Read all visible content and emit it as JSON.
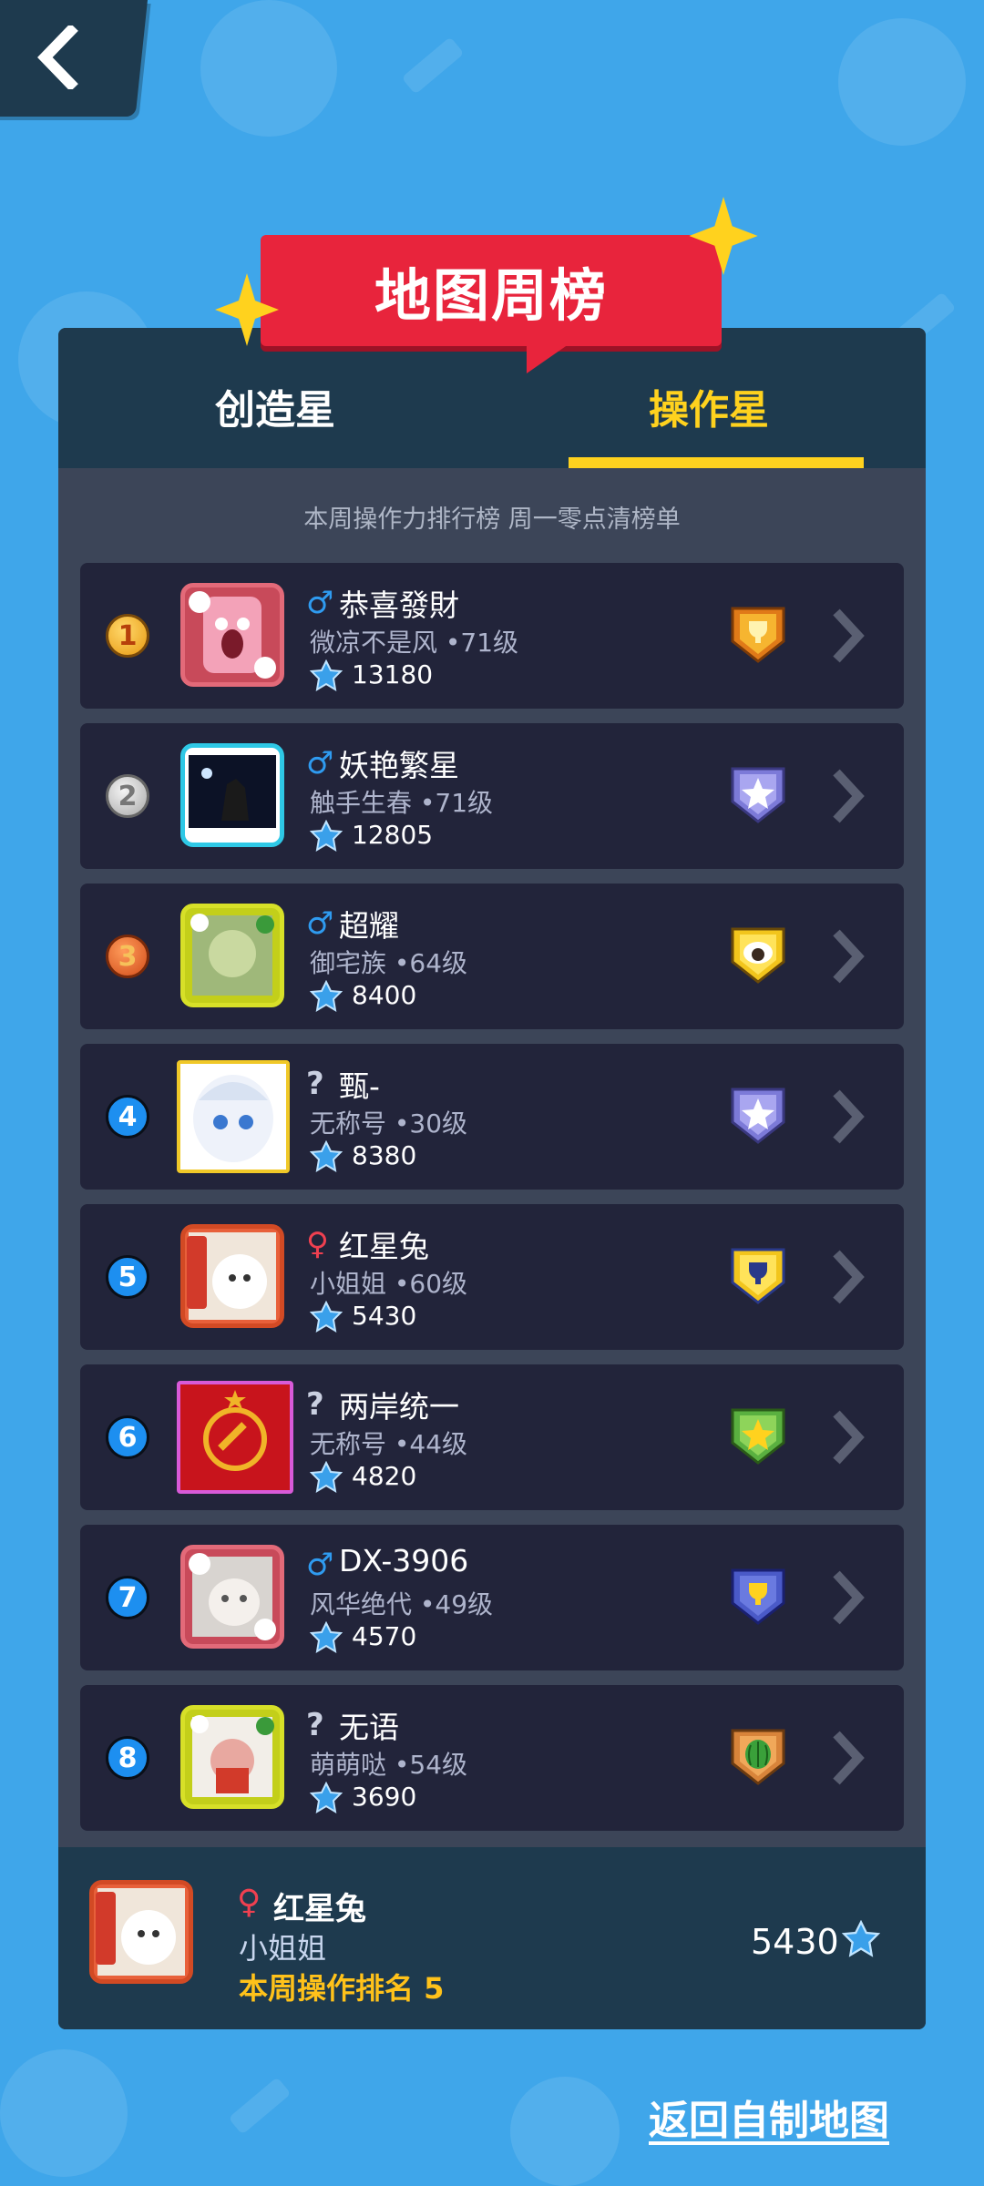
{
  "header": {
    "back_label": "back",
    "title": "地图周榜"
  },
  "tabs": [
    {
      "label": "创造星",
      "active": false
    },
    {
      "label": "操作星",
      "active": true
    }
  ],
  "notice": "本周操作力排行榜 周一零点清榜单",
  "entries": [
    {
      "rank": "1",
      "gender": "♂",
      "name": "恭喜發財",
      "subtitle": "微凉不是风 •71级",
      "score": "13180",
      "badge": "gold-trophy-badge"
    },
    {
      "rank": "2",
      "gender": "♂",
      "name": "妖艳繁星",
      "subtitle": "触手生春 •71级",
      "score": "12805",
      "badge": "purple-star-badge"
    },
    {
      "rank": "3",
      "gender": "♂",
      "name": "超耀",
      "subtitle": "御宅族 •64级",
      "score": "8400",
      "badge": "sheep-badge"
    },
    {
      "rank": "4",
      "gender": "?",
      "name": "甄-",
      "subtitle": "无称号 •30级",
      "score": "8380",
      "badge": "purple-star-badge"
    },
    {
      "rank": "5",
      "gender": "♀",
      "name": "红星兔",
      "subtitle": "小姐姐 •60级",
      "score": "5430",
      "badge": "yellow-trophy-badge"
    },
    {
      "rank": "6",
      "gender": "?",
      "name": "两岸统一",
      "subtitle": "无称号 •44级",
      "score": "4820",
      "badge": "green-star-badge"
    },
    {
      "rank": "7",
      "gender": "♂",
      "name": "DX-3906",
      "subtitle": "风华绝代 •49级",
      "score": "4570",
      "badge": "blue-trophy-badge"
    },
    {
      "rank": "8",
      "gender": "?",
      "name": "无语",
      "subtitle": "萌萌哒 •54级",
      "score": "3690",
      "badge": "watermelon-badge"
    }
  ],
  "me": {
    "gender": "♀",
    "name": "红星兔",
    "subtitle": "小姐姐",
    "rank_text": "本周操作排名 5",
    "score": "5430"
  },
  "footer": {
    "return_link": "返回自制地图"
  },
  "colors": {
    "accent": "#ffd21e",
    "background": "#3fa6ea",
    "panel": "#3c4558",
    "row": "#22243a",
    "banner": "#e8243c"
  }
}
